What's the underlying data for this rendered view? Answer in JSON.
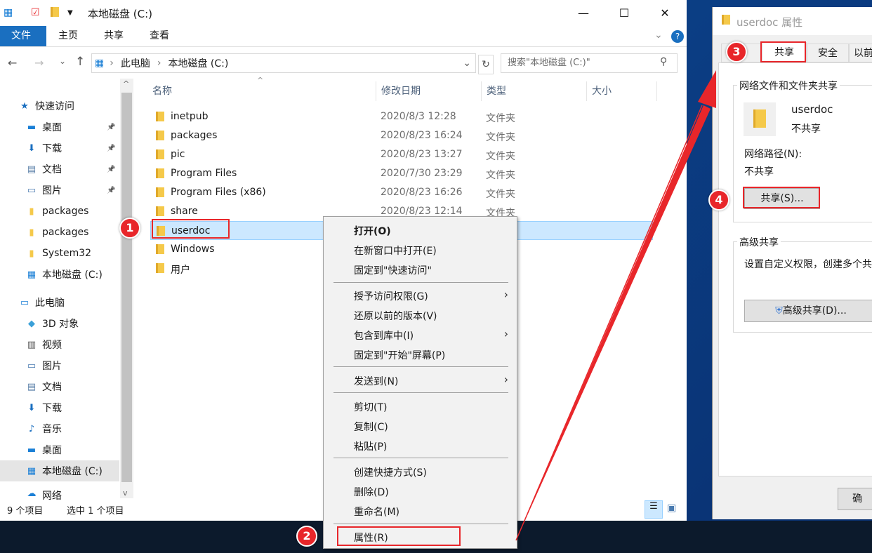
{
  "window": {
    "title": "本地磁盘 (C:)",
    "minimize": "—",
    "maximize": "☐",
    "close": "✕"
  },
  "ribbon": {
    "tabs": [
      "文件",
      "主页",
      "共享",
      "查看"
    ]
  },
  "address": {
    "crumbs": [
      "此电脑",
      "本地磁盘 (C:)"
    ],
    "search_placeholder": "搜索\"本地磁盘 (C:)\""
  },
  "sidebar": {
    "items": [
      {
        "label": "快速访问",
        "icon": "star-icon"
      },
      {
        "label": "桌面",
        "icon": "desktop-icon",
        "pinned": true
      },
      {
        "label": "下载",
        "icon": "download-icon",
        "pinned": true
      },
      {
        "label": "文档",
        "icon": "document-icon",
        "pinned": true
      },
      {
        "label": "图片",
        "icon": "picture-icon",
        "pinned": true
      },
      {
        "label": "packages",
        "icon": "folder-icon"
      },
      {
        "label": "packages",
        "icon": "folder-icon"
      },
      {
        "label": "System32",
        "icon": "folder-icon"
      },
      {
        "label": "本地磁盘 (C:)",
        "icon": "drive-icon"
      },
      {
        "label": "此电脑",
        "icon": "computer-icon"
      },
      {
        "label": "3D 对象",
        "icon": "cube-icon"
      },
      {
        "label": "视频",
        "icon": "video-icon"
      },
      {
        "label": "图片",
        "icon": "picture-icon"
      },
      {
        "label": "文档",
        "icon": "document-icon"
      },
      {
        "label": "下载",
        "icon": "download-icon"
      },
      {
        "label": "音乐",
        "icon": "music-icon"
      },
      {
        "label": "桌面",
        "icon": "desktop-icon"
      },
      {
        "label": "本地磁盘 (C:)",
        "icon": "drive-icon"
      },
      {
        "label": "网络",
        "icon": "network-icon"
      }
    ]
  },
  "columns": [
    "名称",
    "修改日期",
    "类型",
    "大小"
  ],
  "files": [
    {
      "name": "inetpub",
      "date": "2020/8/3 12:28",
      "type": "文件夹"
    },
    {
      "name": "packages",
      "date": "2020/8/23 16:24",
      "type": "文件夹"
    },
    {
      "name": "pic",
      "date": "2020/8/23 13:27",
      "type": "文件夹"
    },
    {
      "name": "Program Files",
      "date": "2020/7/30 23:29",
      "type": "文件夹"
    },
    {
      "name": "Program Files (x86)",
      "date": "2020/8/23 16:26",
      "type": "文件夹"
    },
    {
      "name": "share",
      "date": "2020/8/23 12:14",
      "type": "文件夹"
    },
    {
      "name": "userdoc",
      "date": "",
      "type": ""
    },
    {
      "name": "Windows",
      "date": "",
      "type": ""
    },
    {
      "name": "用户",
      "date": "",
      "type": ""
    }
  ],
  "status": {
    "count": "9 个项目",
    "selected": "选中 1 个项目"
  },
  "context_menu": [
    "打开(O)",
    "在新窗口中打开(E)",
    "固定到\"快速访问\"",
    "授予访问权限(G)",
    "还原以前的版本(V)",
    "包含到库中(I)",
    "固定到\"开始\"屏幕(P)",
    "发送到(N)",
    "剪切(T)",
    "复制(C)",
    "粘贴(P)",
    "创建快捷方式(S)",
    "删除(D)",
    "重命名(M)",
    "属性(R)"
  ],
  "dialog": {
    "title": "userdoc 属性",
    "tabs": [
      "共享",
      "安全",
      "以前"
    ],
    "group1": "网络文件和文件夹共享",
    "folder_name": "userdoc",
    "share_state": "不共享",
    "path_label": "网络路径(N):",
    "path_value": "不共享",
    "share_button": "共享(S)...",
    "group2": "高级共享",
    "group2_desc": "设置自定义权限，创建多个共",
    "adv_button": "高级共享(D)...",
    "ok_button": "确"
  },
  "annotations": [
    "1",
    "2",
    "3",
    "4"
  ],
  "colors": {
    "accent": "#1a6fc0",
    "annotation": "#e8262a",
    "selection": "#cce8ff"
  }
}
